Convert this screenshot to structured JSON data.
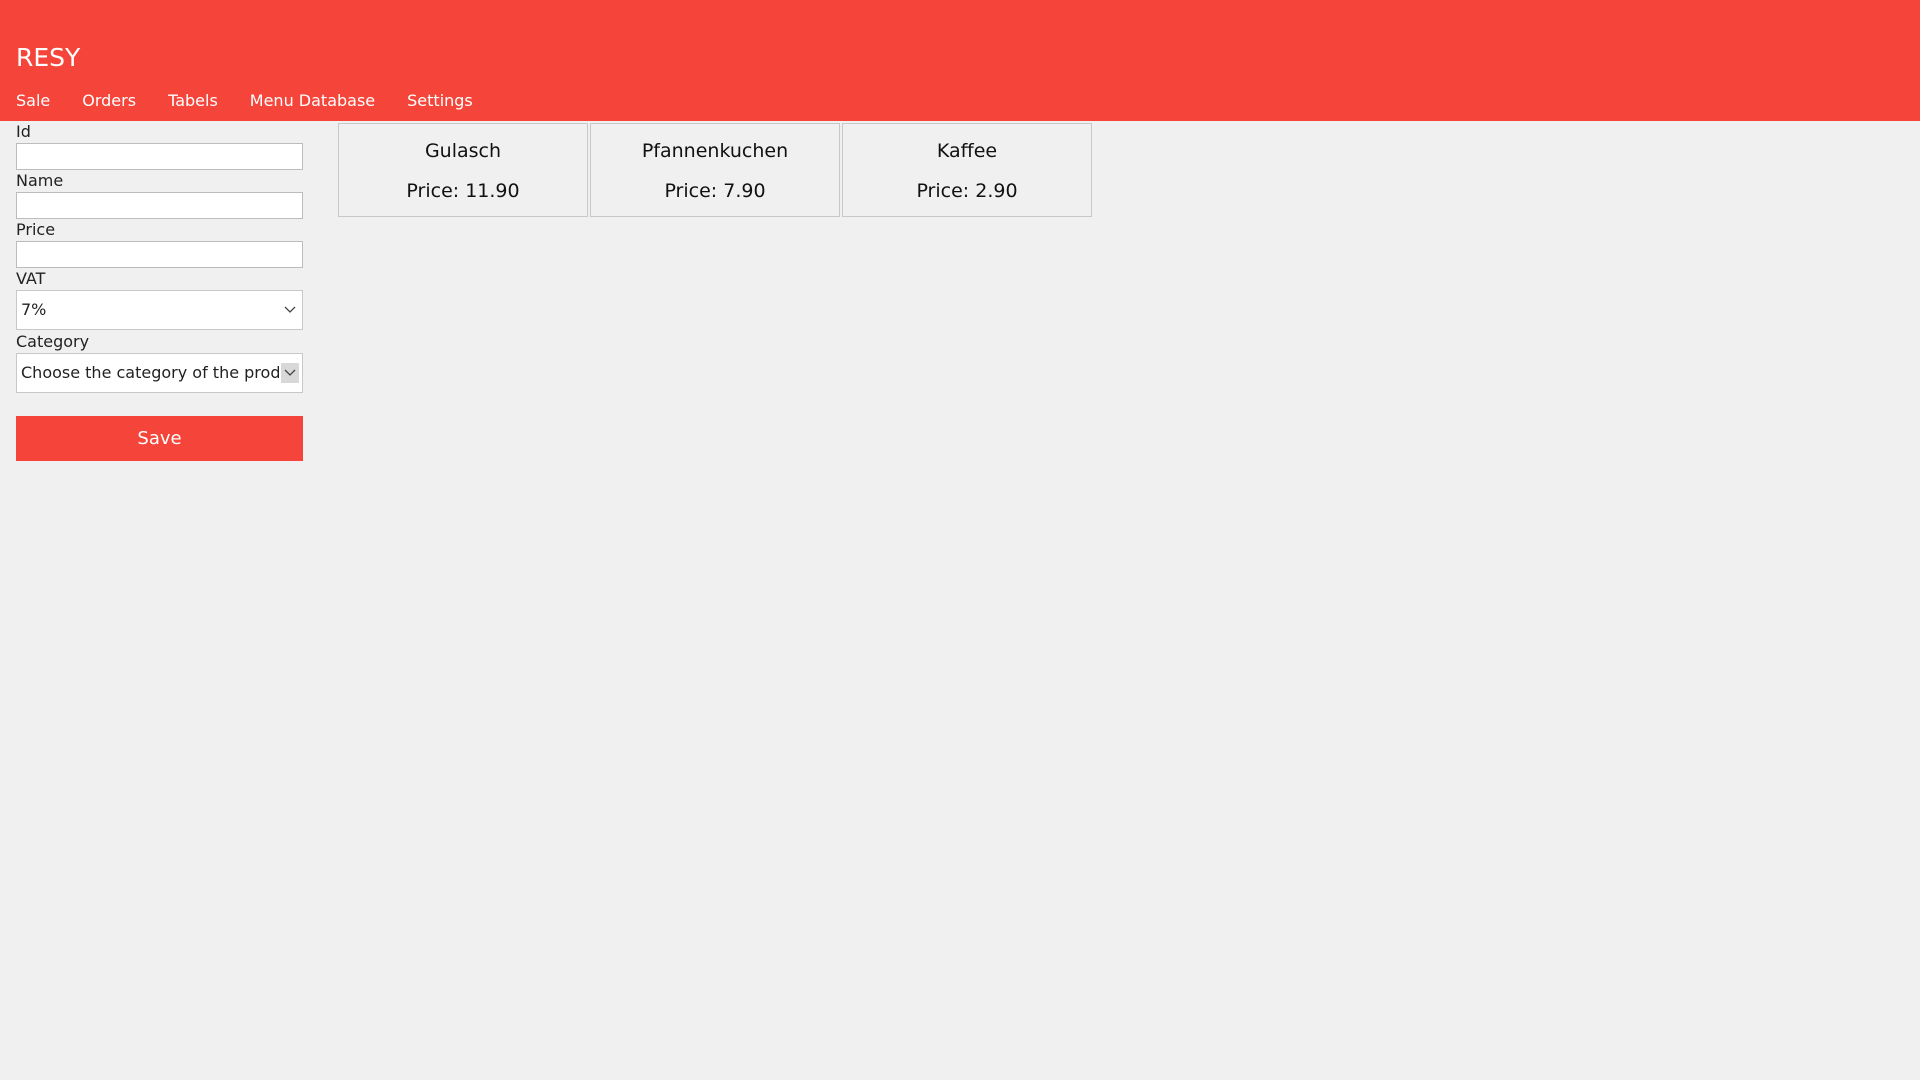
{
  "app": {
    "title": "RESY"
  },
  "nav": {
    "items": [
      "Sale",
      "Orders",
      "Tabels",
      "Menu Database",
      "Settings"
    ]
  },
  "form": {
    "id_label": "Id",
    "id_value": "",
    "name_label": "Name",
    "name_value": "",
    "price_label": "Price",
    "price_value": "",
    "vat_label": "VAT",
    "vat_value": "7%",
    "category_label": "Category",
    "category_value": "Choose the category of the product",
    "save_label": "Save"
  },
  "products": [
    {
      "name": "Gulasch",
      "price_text": "Price: 11.90"
    },
    {
      "name": "Pfannenkuchen",
      "price_text": "Price: 7.90"
    },
    {
      "name": "Kaffee",
      "price_text": "Price: 2.90"
    }
  ],
  "colors": {
    "accent": "#f5443a",
    "background": "#f0f0f0"
  },
  "icons": {
    "dropdown": "chevron-down-icon"
  }
}
